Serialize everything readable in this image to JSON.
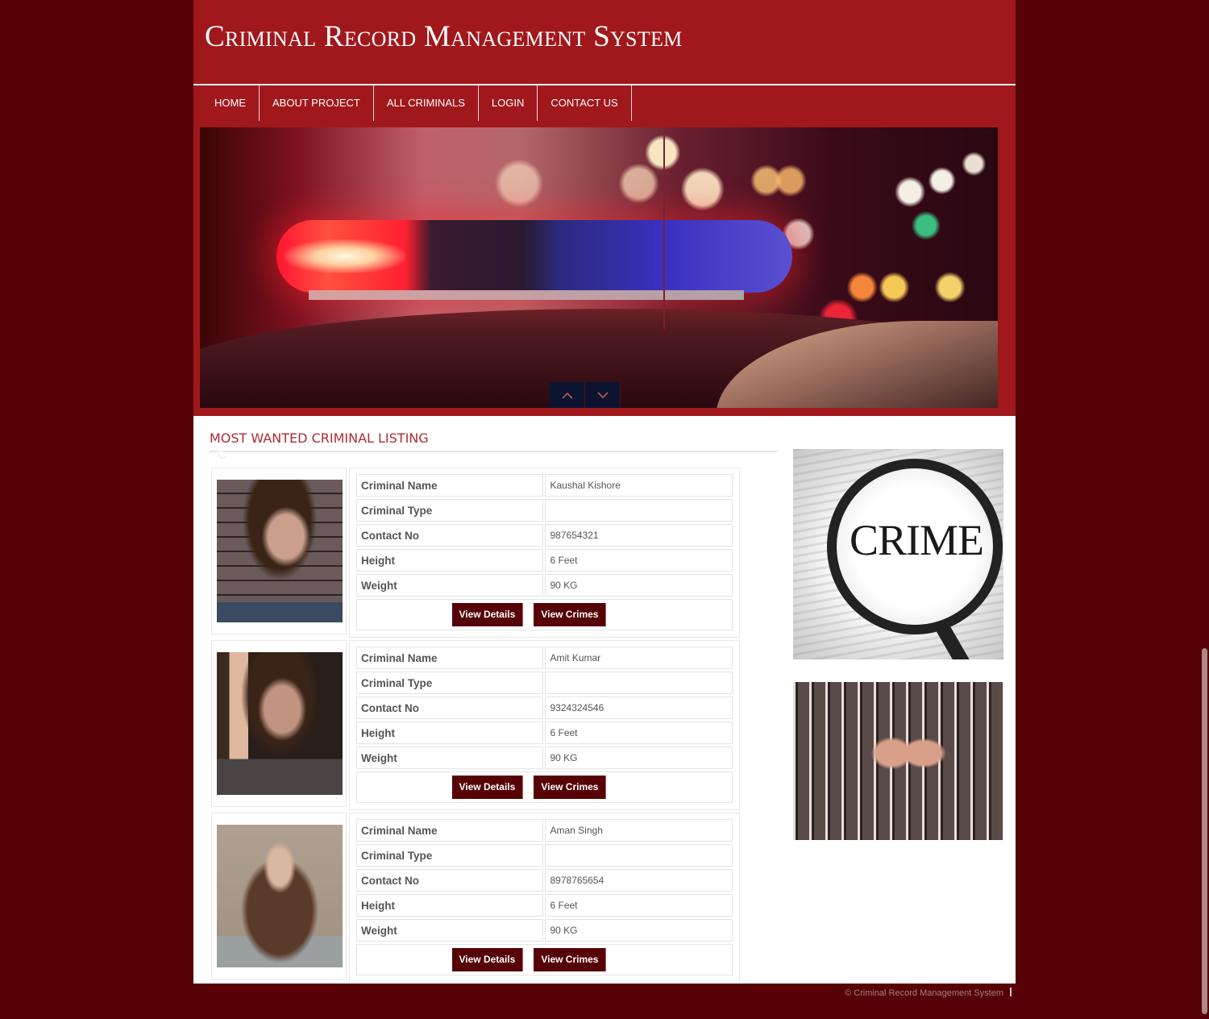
{
  "header": {
    "site_title": "Criminal Record Management System"
  },
  "nav": {
    "items": [
      {
        "label": "HOME"
      },
      {
        "label": "ABOUT PROJECT"
      },
      {
        "label": "ALL CRIMINALS"
      },
      {
        "label": "LOGIN"
      },
      {
        "label": "CONTACT US"
      }
    ]
  },
  "banner": {
    "prev_icon": "chevron-up-icon",
    "next_icon": "chevron-down-icon"
  },
  "listing": {
    "heading": "MOST WANTED CRIMINAL LISTING",
    "field_labels": {
      "name": "Criminal Name",
      "type": "Criminal Type",
      "contact": "Contact No",
      "height": "Height",
      "weight": "Weight"
    },
    "buttons": {
      "details": "View Details",
      "crimes": "View Crimes"
    },
    "records": [
      {
        "name": "Kaushal Kishore",
        "type": "",
        "contact": "987654321",
        "height": "6 Feet",
        "weight": "90 KG"
      },
      {
        "name": "Amit Kumar",
        "type": "",
        "contact": "9324324546",
        "height": "6 Feet",
        "weight": "90 KG"
      },
      {
        "name": "Aman Singh",
        "type": "",
        "contact": "8978765654",
        "height": "6 Feet",
        "weight": "90 KG"
      }
    ]
  },
  "sidebar": {
    "crime_image_text": "CRIME"
  },
  "footer": {
    "copyright": "© Criminal Record Management System"
  },
  "colors": {
    "page_bg": "#560206",
    "header_red": "#a0181c",
    "button_bg": "#560206",
    "heading_red": "#b02a30"
  }
}
